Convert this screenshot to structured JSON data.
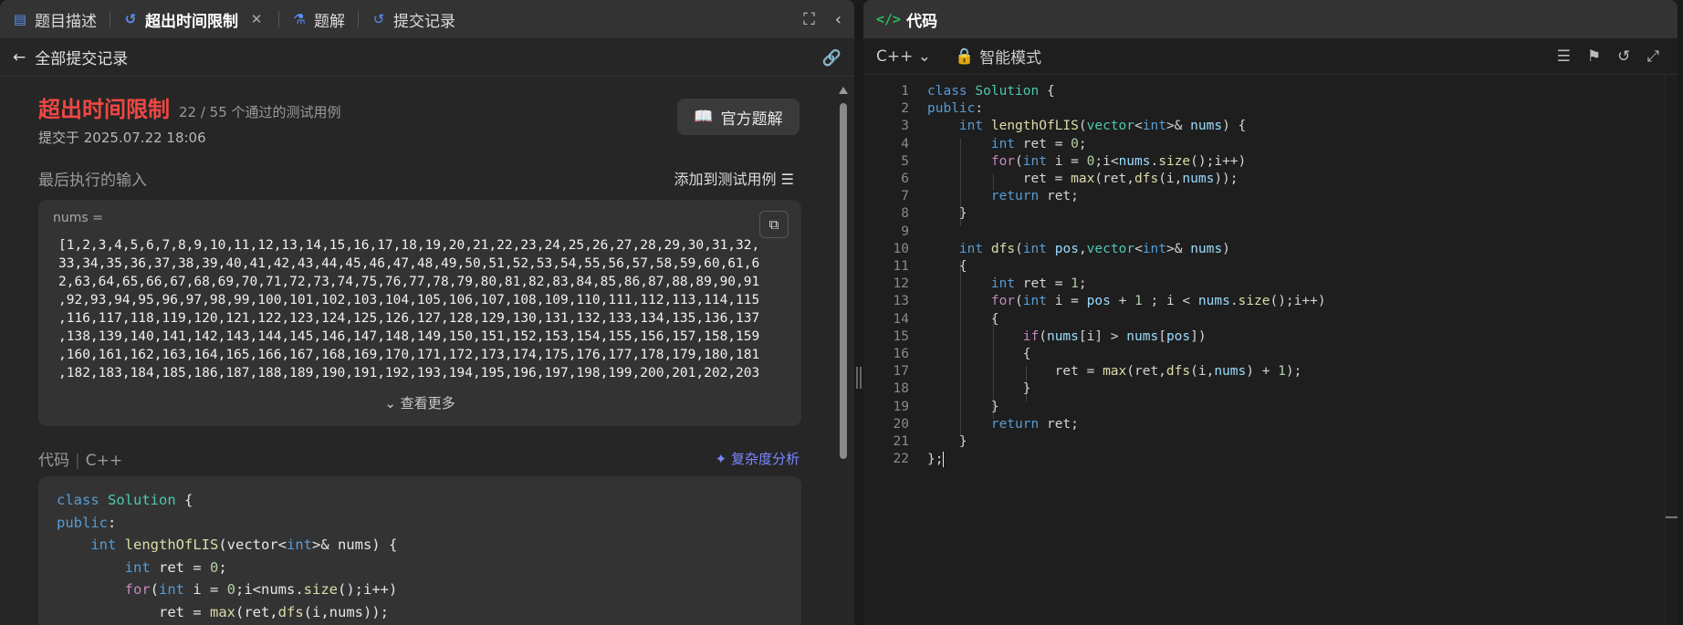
{
  "tabs": [
    {
      "label": "题目描述",
      "icon": "document-icon"
    },
    {
      "label": "超出时间限制",
      "icon": "history-icon",
      "active": true
    },
    {
      "label": "题解",
      "icon": "flask-icon"
    },
    {
      "label": "提交记录",
      "icon": "history-icon"
    }
  ],
  "back_label": "全部提交记录",
  "result": {
    "status": "超出时间限制",
    "cases": "22 / 55 个通过的测试用例",
    "submitted": "提交于 2025.07.22 18:06",
    "solution_btn": "官方题解",
    "status_color": "#ef4743"
  },
  "last_input": {
    "title": "最后执行的输入",
    "add_testcase": "添加到测试用例",
    "param": "nums =",
    "value_lines": [
      "[1,2,3,4,5,6,7,8,9,10,11,12,13,14,15,16,17,18,19,20,21,22,23,24,25,26,27,28,29,30,31,32,",
      "33,34,35,36,37,38,39,40,41,42,43,44,45,46,47,48,49,50,51,52,53,54,55,56,57,58,59,60,61,6",
      "2,63,64,65,66,67,68,69,70,71,72,73,74,75,76,77,78,79,80,81,82,83,84,85,86,87,88,89,90,91",
      ",92,93,94,95,96,97,98,99,100,101,102,103,104,105,106,107,108,109,110,111,112,113,114,115",
      ",116,117,118,119,120,121,122,123,124,125,126,127,128,129,130,131,132,133,134,135,136,137",
      ",138,139,140,141,142,143,144,145,146,147,148,149,150,151,152,153,154,155,156,157,158,159",
      ",160,161,162,163,164,165,166,167,168,169,170,171,172,173,174,175,176,177,178,179,180,181",
      ",182,183,184,185,186,187,188,189,190,191,192,193,194,195,196,197,198,199,200,201,202,203"
    ],
    "show_more": "查看更多"
  },
  "submitted_code": {
    "title": "代码",
    "lang": "C++",
    "complexity": "复杂度分析"
  },
  "editor": {
    "title": "代码",
    "language": "C++",
    "mode": "智能模式",
    "accent": "#2cbb5d"
  },
  "code_lines": [
    "class Solution {",
    "public:",
    "    int lengthOfLIS(vector<int>& nums) {",
    "        int ret = 0;",
    "        for(int i = 0;i<nums.size();i++)",
    "            ret = max(ret,dfs(i,nums));",
    "        return ret;",
    "    }",
    "",
    "    int dfs(int pos,vector<int>& nums)",
    "    {",
    "        int ret = 1;",
    "        for(int i = pos + 1 ; i < nums.size();i++)",
    "        {",
    "            if(nums[i] > nums[pos])",
    "            {",
    "                ret = max(ret,dfs(i,nums) + 1);",
    "            }",
    "        }",
    "        return ret;",
    "    }",
    "};"
  ]
}
